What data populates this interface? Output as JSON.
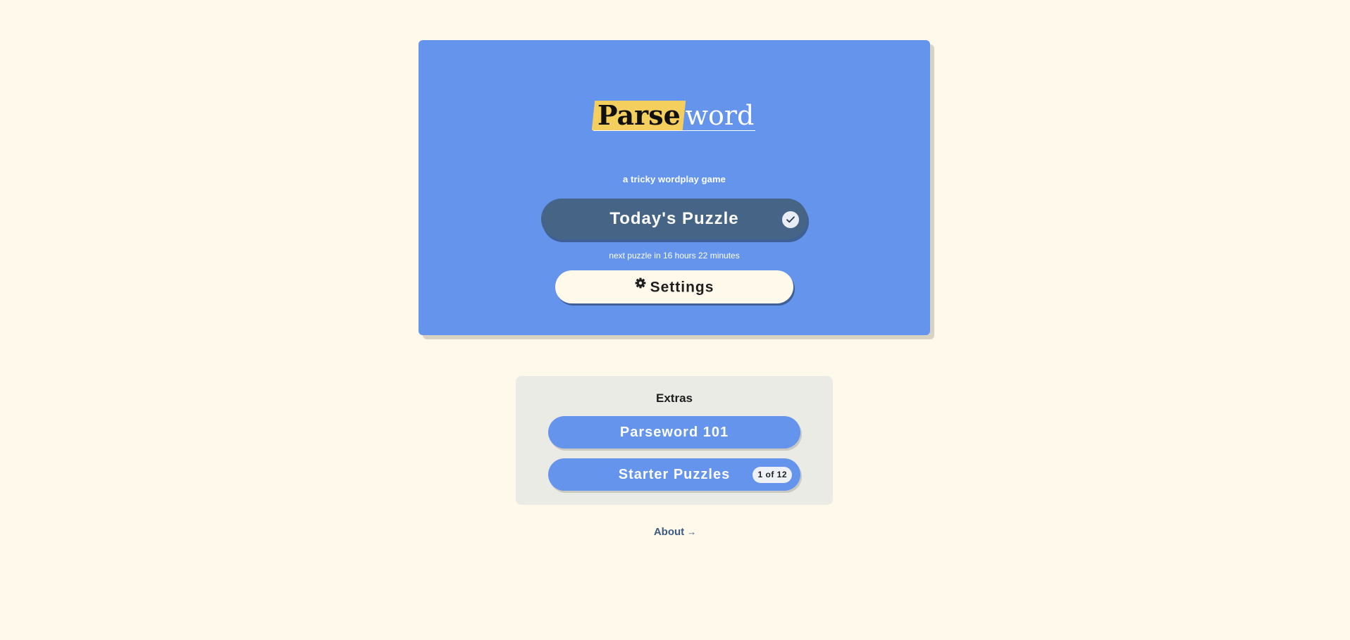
{
  "logo": {
    "highlight": "Parse",
    "rest": "word",
    "tagline": "a tricky wordplay game"
  },
  "today": {
    "label": "Today's Puzzle",
    "icon": "check-circle-icon",
    "next_text": "next puzzle in 16 hours 22 minutes"
  },
  "settings": {
    "label": "Settings",
    "icon": "gear-icon"
  },
  "extras": {
    "title": "Extras",
    "items": [
      {
        "label": "Parseword 101"
      },
      {
        "label": "Starter Puzzles",
        "badge": "1 of 12"
      }
    ]
  },
  "about": {
    "label": "About",
    "arrow": "→",
    "icon": "arrow-right-icon"
  },
  "colors": {
    "background": "#fef9eb",
    "hero": "#6594ec",
    "today_button": "#456486",
    "logo_highlight": "#f5cf5e",
    "extras_panel": "#ebebe6",
    "about_link": "#3d5a80"
  }
}
